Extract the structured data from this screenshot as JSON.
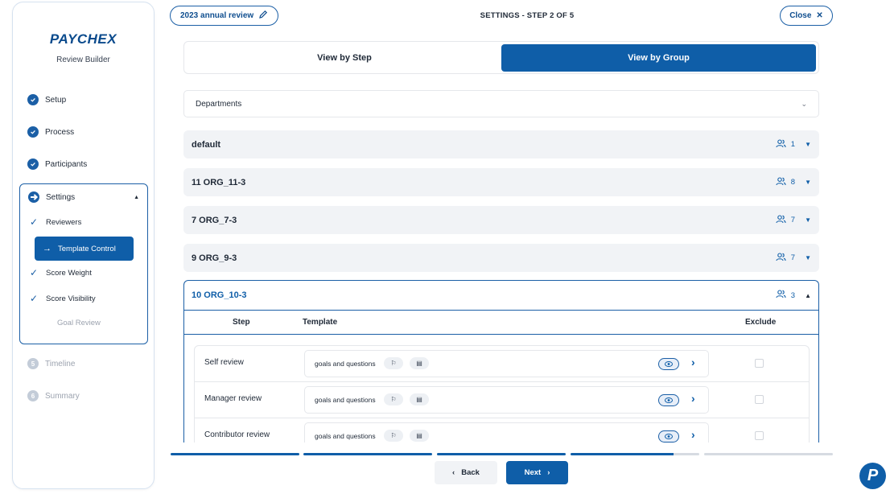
{
  "sidebar": {
    "logo": "PAYCHEX",
    "subtitle": "Review Builder",
    "steps": [
      {
        "label": "Setup",
        "state": "done"
      },
      {
        "label": "Process",
        "state": "done"
      },
      {
        "label": "Participants",
        "state": "done"
      }
    ],
    "settings": {
      "label": "Settings",
      "sub_items": [
        {
          "label": "Reviewers",
          "state": "done"
        },
        {
          "label": "Template Control",
          "state": "active"
        },
        {
          "label": "Score Weight",
          "state": "done"
        },
        {
          "label": "Score Visibility",
          "state": "done"
        },
        {
          "label": "Goal Review",
          "state": "disabled"
        }
      ]
    },
    "future_steps": [
      {
        "num": "5",
        "label": "Timeline"
      },
      {
        "num": "6",
        "label": "Summary"
      }
    ]
  },
  "header": {
    "review_name": "2023 annual review",
    "step_title": "SETTINGS - STEP 2 OF 5",
    "close_label": "Close"
  },
  "view_toggle": {
    "by_step": "View by Step",
    "by_group": "View by Group",
    "selected": "View by Group"
  },
  "filter": {
    "value": "Departments"
  },
  "groups": [
    {
      "name": "default",
      "count": "1"
    },
    {
      "name": "11 ORG_11-3",
      "count": "8"
    },
    {
      "name": "7 ORG_7-3",
      "count": "7"
    },
    {
      "name": "9 ORG_9-3",
      "count": "7"
    }
  ],
  "open_group": {
    "name": "10 ORG_10-3",
    "count": "3",
    "columns": {
      "step": "Step",
      "template": "Template",
      "exclude": "Exclude"
    },
    "rows": [
      {
        "step": "Self review",
        "template": "goals and questions"
      },
      {
        "step": "Manager review",
        "template": "goals and questions"
      },
      {
        "step": "Contributor review",
        "template": "goals and questions"
      }
    ]
  },
  "progress": {
    "segments": [
      1,
      1,
      1,
      0.8,
      0
    ]
  },
  "footer": {
    "back_label": "Back",
    "next_label": "Next"
  },
  "colors": {
    "primary": "#0f5ea8",
    "accent_border": "#1b5fa6",
    "muted": "#9ca3af",
    "row_bg": "#f1f3f6"
  },
  "help_fab": "P"
}
